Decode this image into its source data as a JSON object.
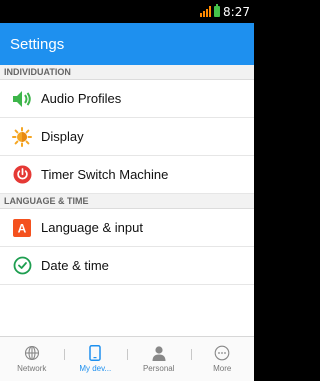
{
  "status": {
    "time": "8:27"
  },
  "app_bar": {
    "title": "Settings"
  },
  "sections": [
    {
      "header": "INDIVIDUATION",
      "items": [
        {
          "label": "Audio Profiles",
          "icon": "speaker-icon"
        },
        {
          "label": "Display",
          "icon": "brightness-icon"
        },
        {
          "label": "Timer Switch Machine",
          "icon": "power-icon"
        }
      ]
    },
    {
      "header": "LANGUAGE & TIME",
      "items": [
        {
          "label": "Language & input",
          "icon": "language-icon"
        },
        {
          "label": "Date & time",
          "icon": "clock-icon"
        }
      ]
    }
  ],
  "tabs": [
    {
      "label": "Network",
      "icon": "globe-icon",
      "active": false
    },
    {
      "label": "My dev...",
      "icon": "phone-icon",
      "active": true
    },
    {
      "label": "Personal",
      "icon": "person-icon",
      "active": false
    },
    {
      "label": "More",
      "icon": "more-icon",
      "active": false
    }
  ],
  "colors": {
    "accent": "#1e90ef",
    "signal": "#ff8a00",
    "battery": "#44c34a"
  }
}
